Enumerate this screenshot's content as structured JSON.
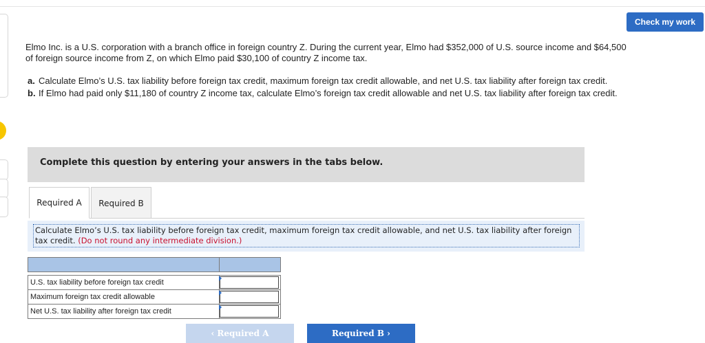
{
  "header": {
    "check_label": "Check my work"
  },
  "question": {
    "intro": "Elmo Inc. is a U.S. corporation with a branch office in foreign country Z. During the current year, Elmo had $352,000 of U.S. source income and $64,500 of foreign source income from Z, on which Elmo paid $30,100 of country Z income tax.",
    "parts": [
      {
        "label": "a.",
        "text": "Calculate Elmo’s U.S. tax liability before foreign tax credit, maximum foreign tax credit allowable, and net U.S. tax liability after foreign tax credit."
      },
      {
        "label": "b.",
        "text": "If Elmo had paid only $11,180 of country Z income tax, calculate Elmo’s foreign tax credit allowable and net U.S. tax liability after foreign tax credit."
      }
    ]
  },
  "banner": {
    "text": "Complete this question by entering your answers in the tabs below."
  },
  "tabs": [
    {
      "label": "Required A",
      "active": true
    },
    {
      "label": "Required B",
      "active": false
    }
  ],
  "instruction": {
    "text": "Calculate Elmo’s U.S. tax liability before foreign tax credit, maximum foreign tax credit allowable, and net U.S. tax liability after foreign tax credit.",
    "note": "(Do not round any intermediate division.)"
  },
  "table": {
    "rows": [
      {
        "label": "U.S. tax liability before foreign tax credit",
        "value": ""
      },
      {
        "label": "Maximum foreign tax credit allowable",
        "value": ""
      },
      {
        "label": "Net U.S. tax liability after foreign tax credit",
        "value": ""
      }
    ]
  },
  "nav": {
    "prev": "‹  Required A",
    "next": "Required B  ›"
  },
  "colors": {
    "accent": "#2d6cc4",
    "header_cell": "#a9c4e6",
    "warning": "#c8102e",
    "dot": "#f7c600"
  }
}
